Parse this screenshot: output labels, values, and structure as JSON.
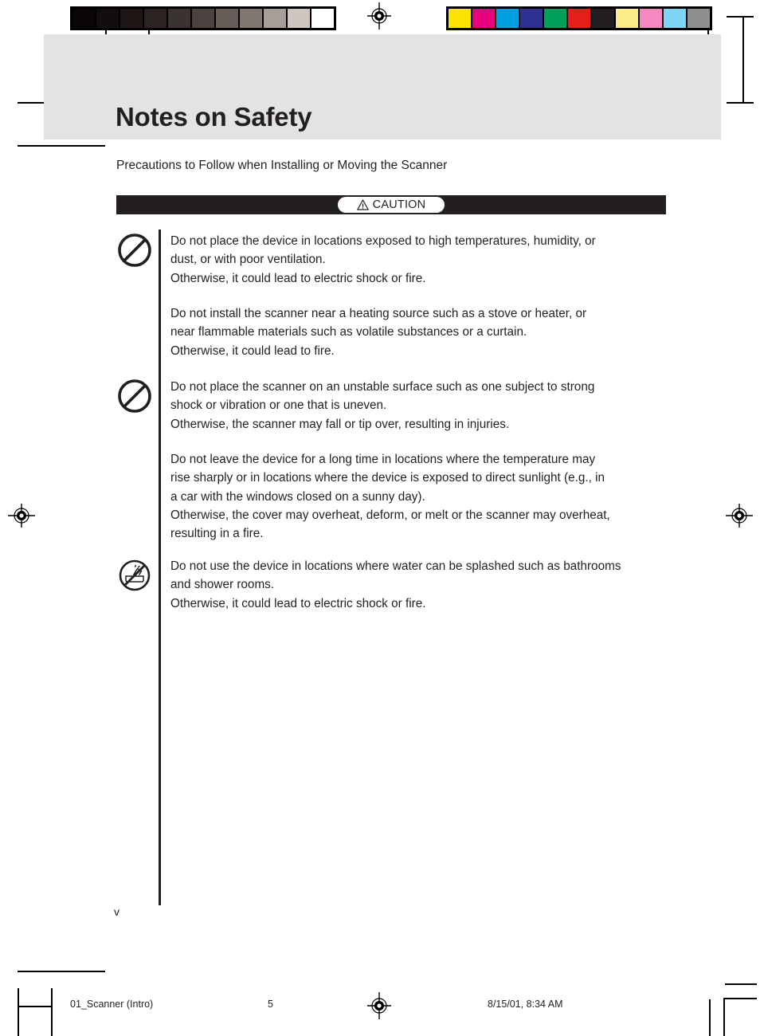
{
  "document": {
    "title": "Notes on Safety",
    "subtitle": "Precautions to Follow when Installing or Moving the Scanner",
    "folio": "v"
  },
  "caution": {
    "label": "CAUTION",
    "icon": "warning-triangle-icon"
  },
  "notices": [
    {
      "icon": "prohibition-icon",
      "lines": [
        "Do not place the device in locations exposed to high temperatures, humidity, or",
        "dust, or with poor ventilation.",
        "Otherwise, it could lead to electric shock or fire."
      ]
    },
    {
      "icon": "none",
      "lines": [
        "Do not install the scanner near a heating source such as a stove or heater, or",
        "near flammable materials such as volatile substances or a curtain.",
        "Otherwise, it could lead to fire."
      ]
    },
    {
      "icon": "prohibition-icon",
      "lines": [
        "Do not place the scanner on an unstable surface such as one subject to strong",
        "shock or vibration or one that is uneven.",
        "Otherwise, the scanner may fall or tip over, resulting in injuries."
      ]
    },
    {
      "icon": "none",
      "lines": [
        "Do not leave the device for a long time in locations where the temperature may",
        "rise sharply or in locations where the device is exposed to direct sunlight (e.g., in",
        "a car with the windows closed on a sunny day).",
        "Otherwise, the cover may overheat, deform, or melt or the scanner may overheat,",
        "resulting in a fire."
      ]
    },
    {
      "icon": "no-water-splash-icon",
      "lines": [
        "Do not use the device in locations where water can be splashed such as bathrooms",
        "and shower rooms.",
        "Otherwise, it could lead to electric shock or fire."
      ]
    }
  ],
  "footer": {
    "file": "01_Scanner (Intro)",
    "page": "5",
    "timestamp": "8/15/01, 8:34 AM"
  },
  "calibration": {
    "gray_bar": {
      "name": "grayscale-step-wedge",
      "patches": [
        "#0a0506",
        "#120d0e",
        "#1d1615",
        "#2a2321",
        "#3b332f",
        "#4c433e",
        "#675c57",
        "#837771",
        "#a89e99",
        "#cfc6c2",
        "#ffffff"
      ]
    },
    "color_bar": {
      "name": "color-control-patches",
      "patches": [
        "#fbe400",
        "#e6007e",
        "#00a0e0",
        "#2e3191",
        "#00a05a",
        "#e51e19",
        "#231f20",
        "#fdec8a",
        "#f389bf",
        "#7fd4f5",
        "#908f8f"
      ]
    }
  }
}
